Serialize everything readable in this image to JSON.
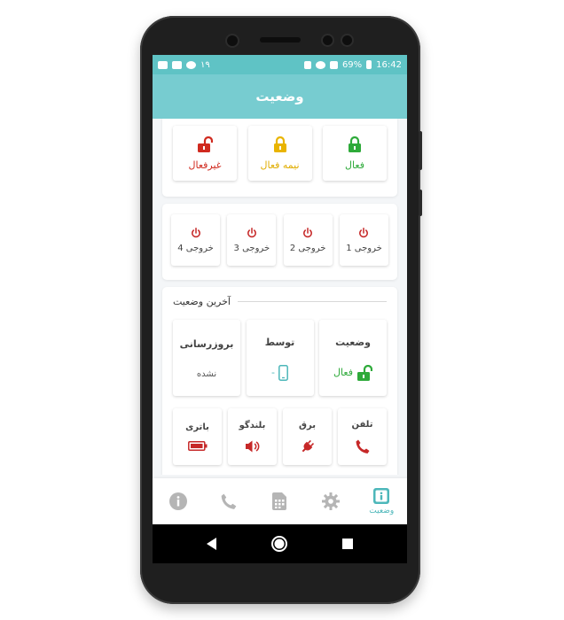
{
  "status_bar": {
    "left_text": "۱۹",
    "battery": "69%",
    "time": "16:42"
  },
  "app_bar": {
    "title": "وضعیت"
  },
  "modes": [
    {
      "label": "فعال",
      "color": "#2eaa3a",
      "icon": "lock-closed-icon"
    },
    {
      "label": "نیمه فعال",
      "color": "#e9b400",
      "icon": "lock-closed-icon"
    },
    {
      "label": "غیرفعال",
      "color": "#d02a1f",
      "icon": "lock-open-icon"
    }
  ],
  "outputs": [
    {
      "label": "خروجی 1"
    },
    {
      "label": "خروجی 2"
    },
    {
      "label": "خروجی 3"
    },
    {
      "label": "خروجی 4"
    }
  ],
  "last_status": {
    "title": "آخرین وضعیت",
    "status": {
      "title": "وضعیت",
      "value": "فعال",
      "color": "#2eaa3a",
      "icon": "lock-open-icon"
    },
    "by": {
      "title": "توسط",
      "value": "-",
      "color": "#4db7ba",
      "icon": "mobile-icon"
    },
    "updated": {
      "title": "بروزرسانی",
      "value": "نشده"
    }
  },
  "devices": [
    {
      "label": "تلفن",
      "icon": "phone-icon",
      "color": "#c62828"
    },
    {
      "label": "برق",
      "icon": "plug-icon",
      "color": "#c62828"
    },
    {
      "label": "بلندگو",
      "icon": "speaker-icon",
      "color": "#c62828"
    },
    {
      "label": "باتری",
      "icon": "battery-icon",
      "color": "#c62828"
    }
  ],
  "bottom_nav": {
    "active_label": "وضعیت",
    "items": [
      "status-icon",
      "gear-icon",
      "sim-icon",
      "phone-icon",
      "info-icon"
    ]
  },
  "colors": {
    "header": "#77ccd0",
    "statusbar": "#5fc3c5",
    "accent": "#4db7ba",
    "inactive_icon": "#b5b5b5"
  }
}
